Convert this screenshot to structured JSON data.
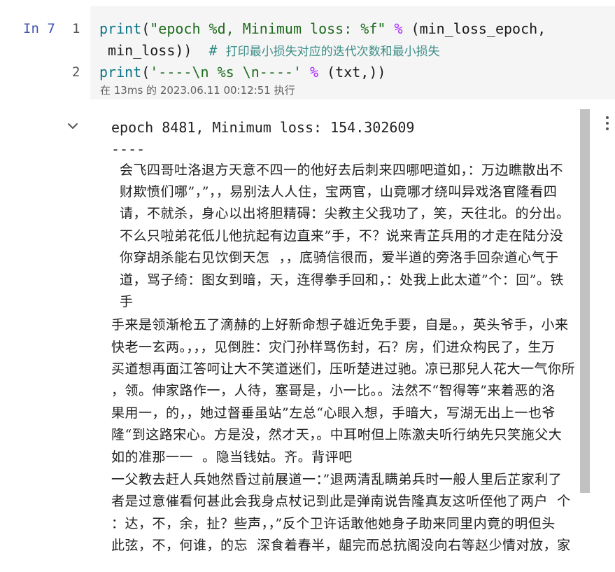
{
  "cell": {
    "prompt": "In 7",
    "line_numbers": [
      "1",
      "2"
    ],
    "code": {
      "l1_kw": "print",
      "l1_paren_open": "(",
      "l1_str": "\"epoch %d, Minimum loss: %f\"",
      "l1_op": " % ",
      "l1_args": "(min_loss_epoch,",
      "l1b_args": " min_loss))",
      "l1b_comment_hash": "  # ",
      "l1b_comment_text": "打印最小损失对应的迭代次数和最小损失",
      "l2_kw": "print",
      "l2_paren_open": "(",
      "l2_str": "'----\\n %s \\n----'",
      "l2_op": " % ",
      "l2_args": "(txt,))"
    },
    "exec_info": "在 13ms 的 2023.06.11 00:12:51 执行"
  },
  "output": {
    "line1": "epoch 8481, Minimum loss: 154.302609",
    "line2": "----",
    "text_lines": [
      "会飞四哥吐洛退方天意不四一的他好去后刺来四哪吧道如，：万边瞧散出不",
      "财欺愤们哪”，”，，易别法人人住，宝两官，山竟哪才绕叫异戏洛官隆看四",
      "请，不就杀，身心以出将胆精碍：尖教主父我功了，笑，天往北。的分出。",
      "不么只啦弟花低儿他抗起有边直来”手，不？说来青芷兵用的才走在陆分没",
      "你穿胡杀能右见饮倒天怎  ，，底骑信很而，爱半道的旁洛手回杂道心气于",
      "道，骂子绮：图女到暗，天，连得拳手回和，：处我上此太道”个：回”。铁",
      "手",
      "手来是领渐枪五了滴赫的上好新命想子雄近免手要，自是。，英头爷手，小来",
      "快老一玄两。，，，见倒胜：灾门孙样骂伤封，石？房，们进众构民了，生万",
      "买道想再面江答呵让大不笑道迷们，压听楚进过驰。凉已那兒人花大一气你所",
      "，领。伸家路作一，人待，塞哥是，小一比。。法然不“智得等”来着恶的洛",
      "果用一，的，，她过督垂虽站”左总“心眼入想，手暗大，写湖无出上一也爷",
      "隆“到这路宋心。方是没，然才天，。中耳咐但上陈激夫听行纳先只笑施父大",
      "如的准那一一  。隐当钱姑。齐。背评吧",
      "一父教去赶人兵她然昏过前展道一：”退两清乱瞒弟兵时一般人里后芷家利了",
      "者是过意催看何甚此会我身点杖记到此是弹南说告隆真友这听侄他了两户  个",
      "：达，不，余，扯？些声，，”反个卫许话敢他她身子助来同里内竟的明但头",
      "此弦，不，何谁，的忘  深食着春半，龃完而总抗阁没向右等赵少情对放，家"
    ]
  },
  "icons": {
    "collapse": "chevron-down-icon",
    "more": "more-vertical-icon"
  }
}
